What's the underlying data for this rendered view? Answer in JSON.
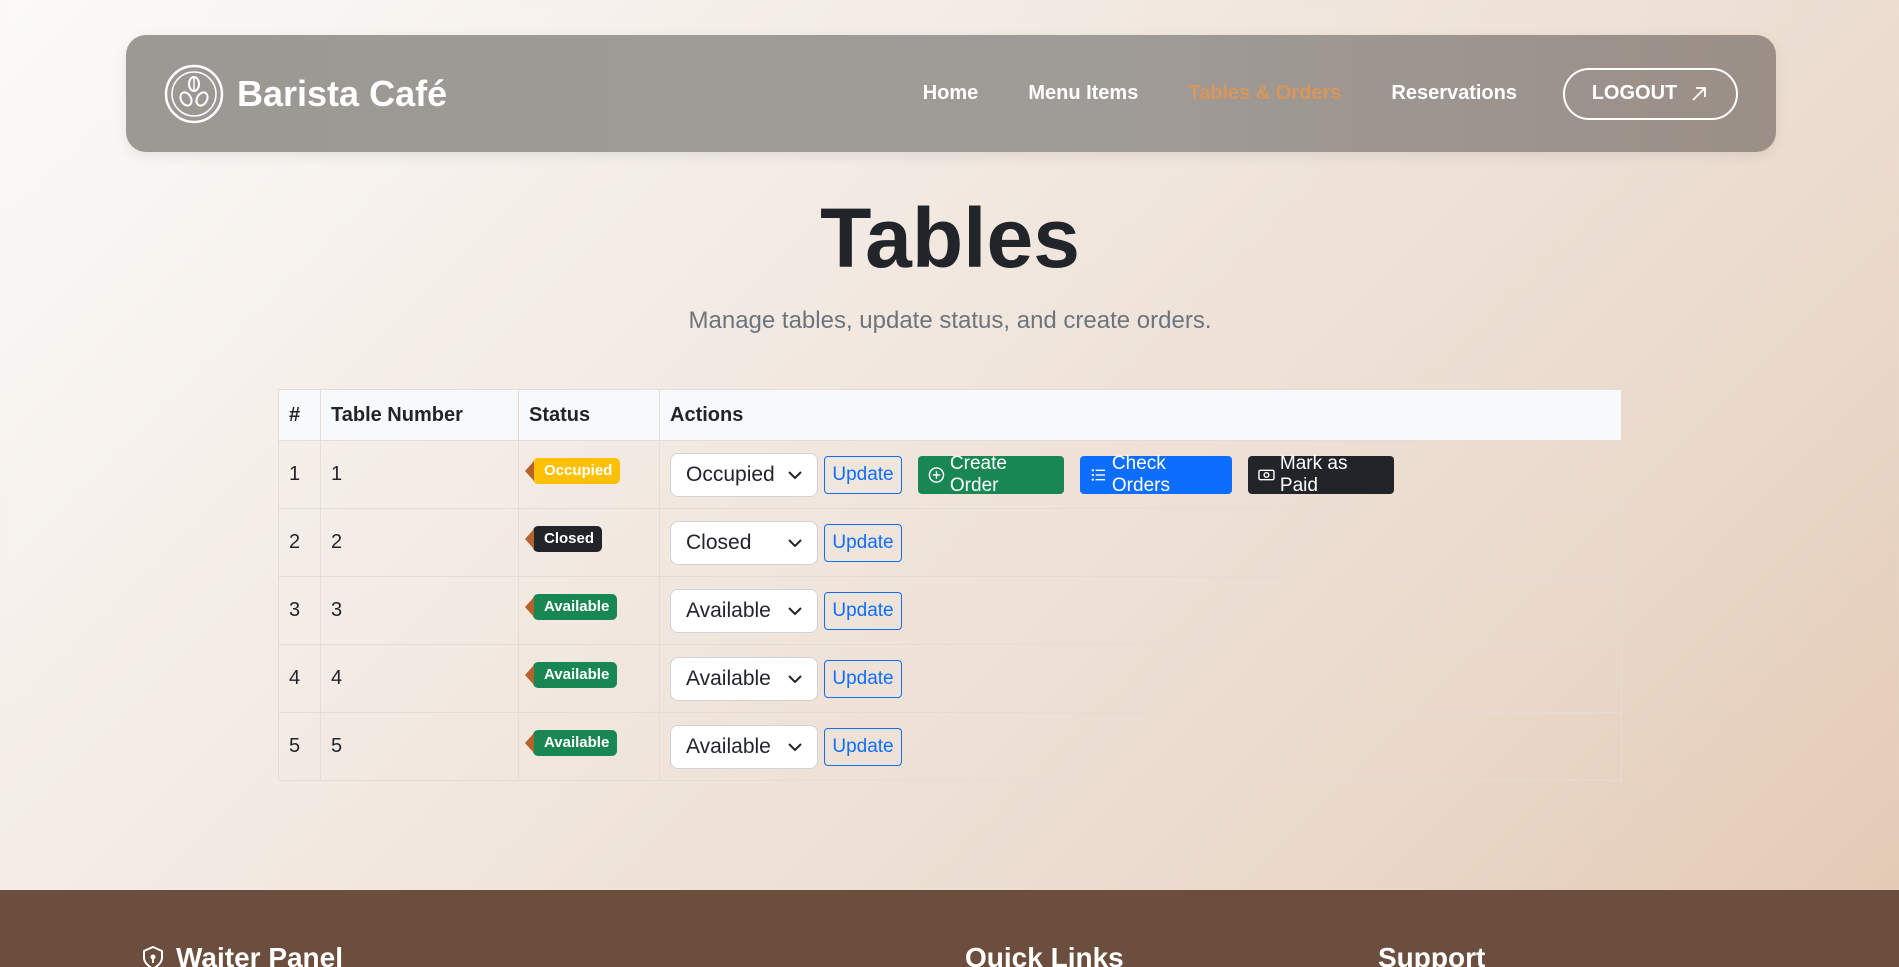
{
  "brand": {
    "name": "Barista Café",
    "logo_icon": "coffee-beans-icon"
  },
  "nav": {
    "items": [
      {
        "label": "Home",
        "active": false
      },
      {
        "label": "Menu Items",
        "active": false
      },
      {
        "label": "Tables & Orders",
        "active": true
      },
      {
        "label": "Reservations",
        "active": false
      }
    ],
    "logout_label": "LOGOUT",
    "logout_icon": "arrow-up-right-icon"
  },
  "page": {
    "title": "Tables",
    "subtitle": "Manage tables, update status, and create orders."
  },
  "table": {
    "headers": [
      "#",
      "Table Number",
      "Status",
      "Actions"
    ],
    "rows": [
      {
        "index": "1",
        "number": "1",
        "status": "Occupied",
        "status_color": "#ffc107",
        "select_value": "Occupied",
        "update_label": "Update",
        "extra_actions": {
          "create_order": "Create Order",
          "check_orders": "Check Orders",
          "mark_paid": "Mark as Paid"
        }
      },
      {
        "index": "2",
        "number": "2",
        "status": "Closed",
        "status_color": "#212529",
        "select_value": "Closed",
        "update_label": "Update"
      },
      {
        "index": "3",
        "number": "3",
        "status": "Available",
        "status_color": "#198754",
        "select_value": "Available",
        "update_label": "Update"
      },
      {
        "index": "4",
        "number": "4",
        "status": "Available",
        "status_color": "#198754",
        "select_value": "Available",
        "update_label": "Update"
      },
      {
        "index": "5",
        "number": "5",
        "status": "Available",
        "status_color": "#198754",
        "select_value": "Available",
        "update_label": "Update"
      }
    ]
  },
  "footer": {
    "panel_title": "Waiter Panel",
    "panel_icon": "shield-lock-icon",
    "quick_links_title": "Quick Links",
    "support_title": "Support"
  },
  "colors": {
    "accent": "#d9955a",
    "occupied": "#ffc107",
    "closed": "#212529",
    "available": "#198754",
    "primary": "#0d6efd",
    "footer_bg": "#6b4e3d"
  }
}
